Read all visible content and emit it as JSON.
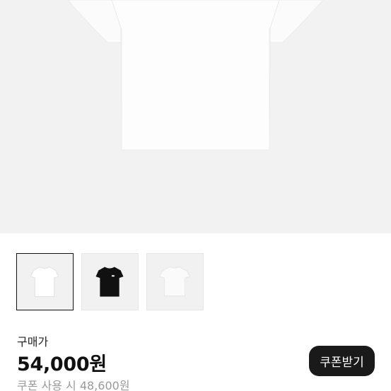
{
  "product": {
    "image_alt": "white t-shirt",
    "thumbnails": [
      {
        "name": "white-tshirt",
        "color": "#ffffff",
        "selected": true
      },
      {
        "name": "black-tshirt",
        "color": "#111111",
        "selected": false
      },
      {
        "name": "white-tshirt-back",
        "color": "#fafafa",
        "selected": false
      }
    ]
  },
  "pricing": {
    "label": "구매가",
    "price": "54,000원",
    "coupon_price": "쿠폰 사용 시 48,600원",
    "coupon_button_label": "쿠폰받기"
  },
  "colors": {
    "hero_bg": "#f2f2f2",
    "button_bg": "#1a1a1a",
    "muted_text": "#9a9a9a"
  }
}
